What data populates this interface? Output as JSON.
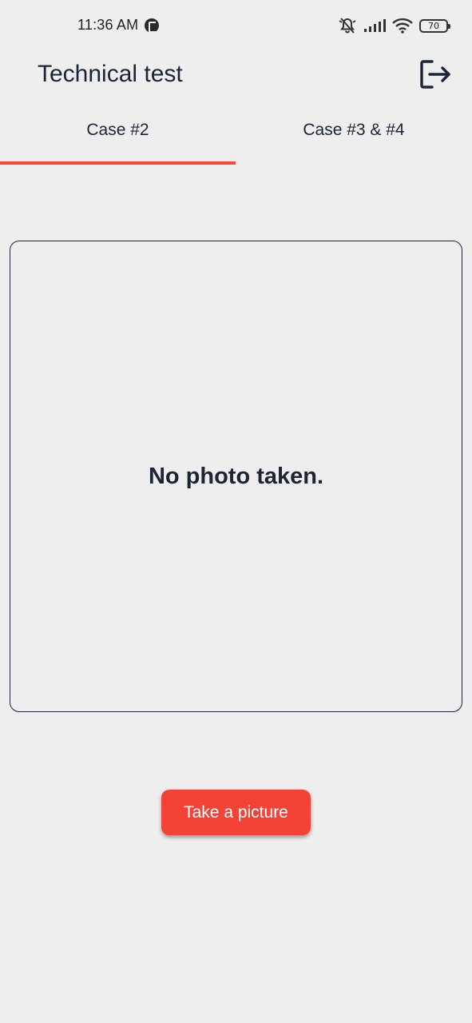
{
  "status_bar": {
    "time": "11:36 AM",
    "battery": "70",
    "icons": [
      "app-notification-icon",
      "mute-icon",
      "signal-icon",
      "wifi-icon",
      "battery-icon"
    ]
  },
  "app_bar": {
    "title": "Technical test",
    "logout_icon": "logout-icon"
  },
  "tabs": [
    {
      "label": "Case #2",
      "selected": true
    },
    {
      "label": "Case #3 & #4",
      "selected": false
    }
  ],
  "photo": {
    "placeholder": "No photo taken."
  },
  "actions": {
    "take_picture_label": "Take a picture"
  },
  "colors": {
    "background": "#eeeeee",
    "text": "#1c2535",
    "accent": "#f44336",
    "tab_indicator": "#f2493b"
  }
}
